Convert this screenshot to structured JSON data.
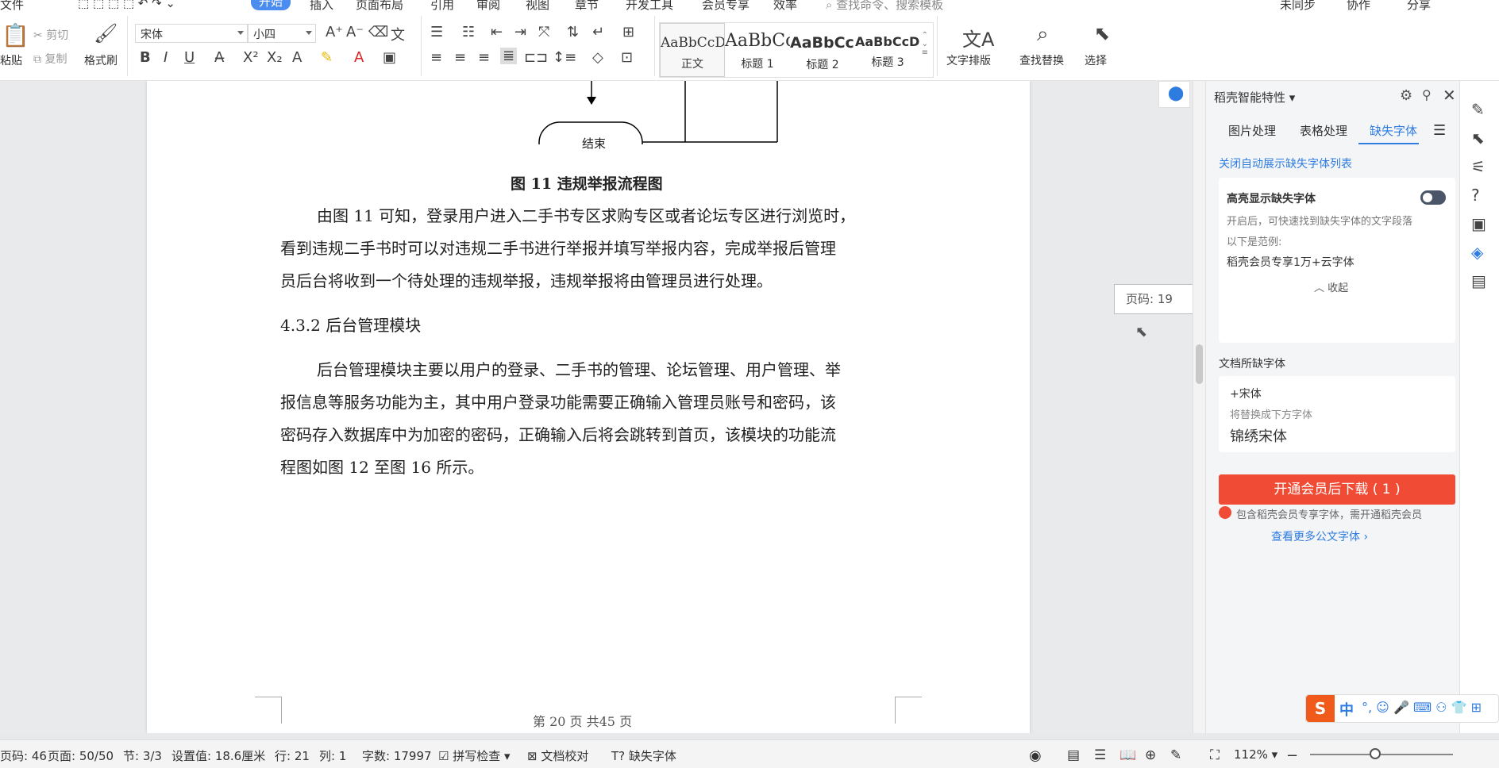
{
  "menubar": {
    "items": [
      "文件",
      "开始",
      "插入",
      "页面布局",
      "引用",
      "审阅",
      "视图",
      "章节",
      "开发工具",
      "会员专享",
      "效率"
    ],
    "search_placeholder": "查找命令、搜索模板",
    "right": [
      "未同步",
      "协作",
      "分享"
    ]
  },
  "ribbon": {
    "paste": "粘贴",
    "cut": "剪切",
    "copy": "复制",
    "format_painter": "格式刷",
    "font_name": "宋体",
    "font_size": "小四",
    "styles": [
      {
        "sample": "AaBbCcDd",
        "label": "正文"
      },
      {
        "sample": "AaBbCc",
        "label": "标题 1"
      },
      {
        "sample": "AaBbCcI",
        "label": "标题 2"
      },
      {
        "sample": "AaBbCcDd",
        "label": "标题 3"
      }
    ],
    "text_layout": "文字排版",
    "find_replace": "查找替换",
    "select": "选择"
  },
  "document": {
    "flow_end": "结束",
    "caption": "图 11 违规举报流程图",
    "para1": [
      "由图 11 可知，登录用户进入二手书专区求购专区或者论坛专区进行浏览时，",
      "看到违规二手书时可以对违规二手书进行举报并填写举报内容，完成举报后管理",
      "员后台将收到一个待处理的违规举报，违规举报将由管理员进行处理。"
    ],
    "heading": "4.3.2 后台管理模块",
    "para2": [
      "后台管理模块主要以用户的登录、二手书的管理、论坛管理、用户管理、举",
      "报信息等服务功能为主，其中用户登录功能需要正确输入管理员账号和密码，该",
      "密码存入数据库中为加密的密码，正确输入后将会跳转到首页，该模块的功能流",
      "程图如图 12 至图 16 所示。"
    ],
    "footer": "第 20 页 共45 页",
    "page_indicator": "页码: 19"
  },
  "panel": {
    "title": "稻壳智能特性",
    "tabs": [
      "图片处理",
      "表格处理",
      "缺失字体"
    ],
    "close_auto": "关闭自动展示缺失字体列表",
    "highlight_title": "高亮显示缺失字体",
    "highlight_desc": "开启后，可快速找到缺失字体的文字段落",
    "example_label": "以下是范例:",
    "example_text": "稻壳会员专享1万+云字体",
    "collapse": "收起",
    "missing_title": "文档所缺字体",
    "missing_font": "+宋体",
    "replace_hint": "将替换成下方字体",
    "replace_font": "锦绣宋体",
    "download_btn": "开通会员后下载 ( 1 )",
    "member_note": "包含稻壳会员专享字体，需开通稻壳会员",
    "more_fonts": "查看更多公文字体"
  },
  "statusbar": {
    "page_code": "页码: 46",
    "pages": "页面: 50/50",
    "section": "节: 3/3",
    "setting": "设置值: 18.6厘米",
    "row": "行: 21",
    "col": "列: 1",
    "words": "字数: 17997",
    "spell": "拼写检查",
    "proof": "文档校对",
    "missing": "缺失字体",
    "zoom": "112%"
  },
  "ime": {
    "mode": "中"
  }
}
